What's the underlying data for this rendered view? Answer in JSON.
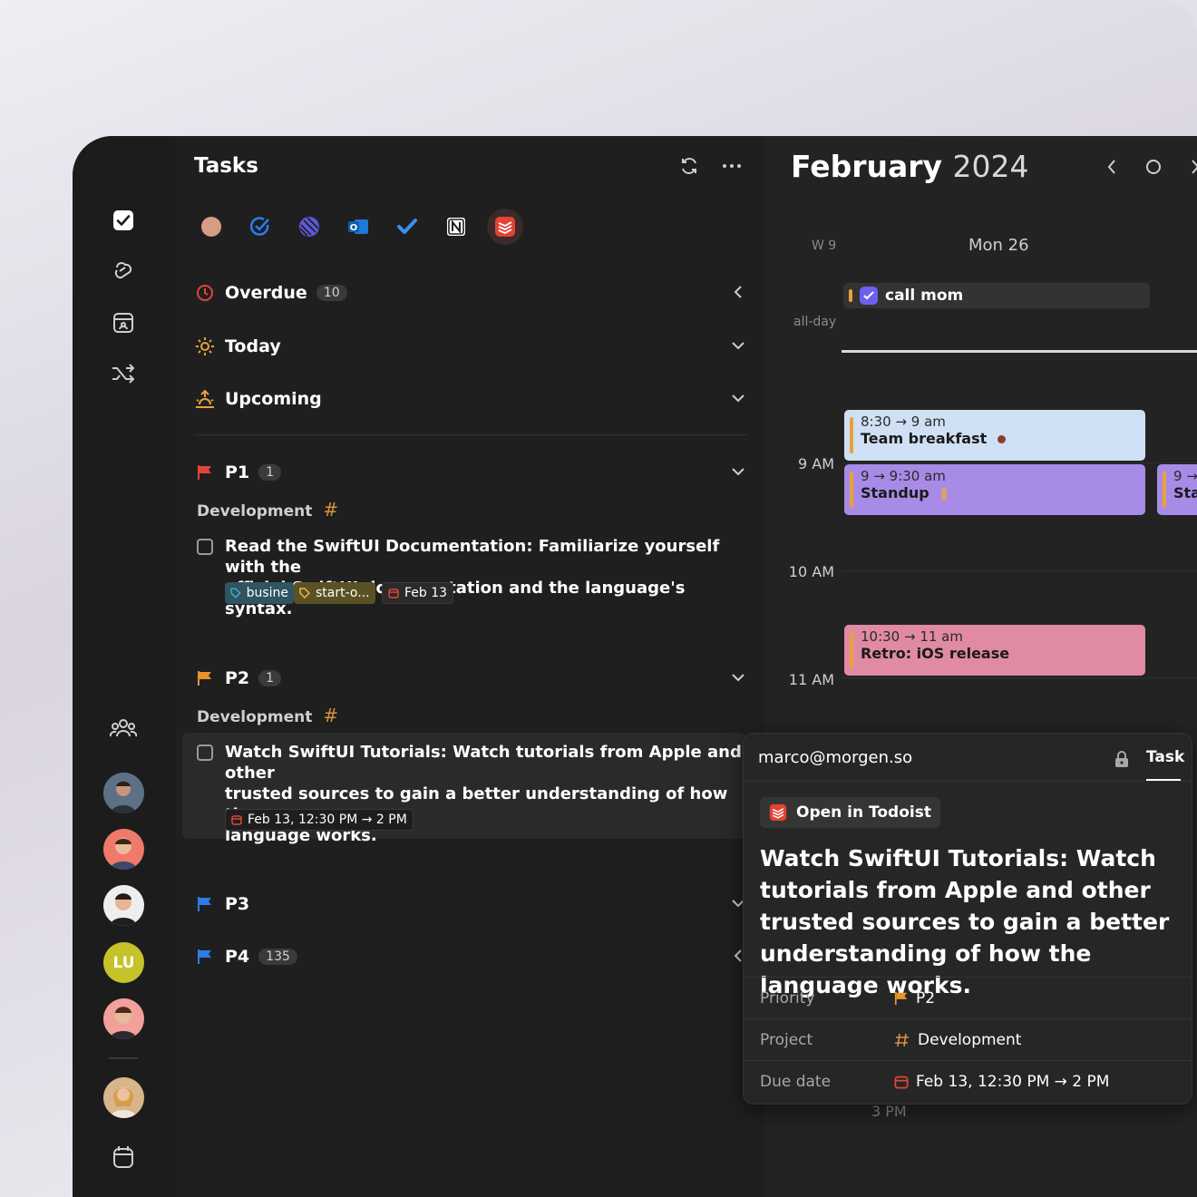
{
  "tasks_panel": {
    "title": "Tasks",
    "sections": [
      {
        "label": "Overdue",
        "count": "10"
      },
      {
        "label": "Today",
        "count": ""
      },
      {
        "label": "Upcoming",
        "count": ""
      }
    ],
    "groups": [
      {
        "label": "P1",
        "count": "1",
        "project": "Development",
        "hash": "#"
      },
      {
        "label": "P2",
        "count": "1",
        "project": "Development",
        "hash": "#"
      },
      {
        "label": "P3",
        "count": ""
      },
      {
        "label": "P4",
        "count": "135"
      }
    ],
    "task1": {
      "text_line1": "Read the SwiftUI Documentation: Familiarize yourself with the",
      "text_line2": "official SwiftUI documentation and the language's syntax.",
      "tag1": "busine",
      "tag2": "start-o...",
      "date": "Feb 13"
    },
    "task2": {
      "text_line1": "Watch SwiftUI Tutorials: Watch tutorials from Apple and other",
      "text_line2": "trusted sources to gain a better understanding of how the",
      "text_line3": "language works.",
      "date": "Feb 13, 12:30 PM → 2 PM"
    }
  },
  "rail": {
    "user_initials": "LU"
  },
  "calendar": {
    "month": "February",
    "year": "2024",
    "week_label": "W 9",
    "day_label": "Mon 26",
    "allday_label": "all-day",
    "allday_event": "call mom",
    "hours": [
      "9 AM",
      "10 AM",
      "11 AM",
      "3 PM"
    ],
    "events": [
      {
        "time": "8:30 → 9 am",
        "name": "Team breakfast",
        "color": "#cfe0f5"
      },
      {
        "time": "9 → 9:30 am",
        "name": "Standup",
        "color": "#a88be6"
      },
      {
        "time": "10:30 → 11 am",
        "name": "Retro: iOS release",
        "color": "#e08aa4"
      },
      {
        "time": "9 →",
        "name": "Sta",
        "color": "#a88be6"
      }
    ]
  },
  "popover": {
    "account": "marco@morgen.so",
    "tab": "Task",
    "open_button": "Open in Todoist",
    "title": "Watch SwiftUI Tutorials: Watch tutorials from Apple and other trusted sources to gain a better understanding of how the language works.",
    "props": [
      {
        "key": "Priority",
        "value": "P2"
      },
      {
        "key": "Project",
        "value": "Development"
      },
      {
        "key": "Due date",
        "value": "Feb 13, 12:30 PM → 2 PM"
      }
    ]
  },
  "colors": {
    "p1": "#e0453a",
    "p2": "#e8932c",
    "p3": "#2f7be8",
    "p4": "#2f7be8",
    "accent": "#6d5ff0"
  }
}
